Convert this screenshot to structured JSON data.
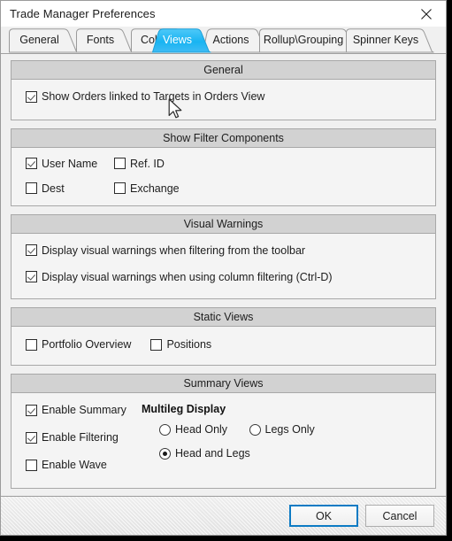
{
  "window": {
    "title": "Trade Manager Preferences",
    "close_icon": "close-icon"
  },
  "tabs": [
    {
      "label": "General",
      "active": false
    },
    {
      "label": "Fonts",
      "active": false
    },
    {
      "label": "Colors",
      "active": false
    },
    {
      "label": "Views",
      "active": true
    },
    {
      "label": "Actions",
      "active": false
    },
    {
      "label": "Rollup\\Grouping",
      "active": false
    },
    {
      "label": "Spinner Keys",
      "active": false
    }
  ],
  "groups": {
    "general": {
      "title": "General",
      "options": [
        {
          "label": "Show Orders linked to Targets in Orders View",
          "checked": true
        }
      ]
    },
    "filter_components": {
      "title": "Show Filter Components",
      "options": [
        {
          "label": "User Name",
          "checked": true
        },
        {
          "label": "Ref. ID",
          "checked": false
        },
        {
          "label": "Dest",
          "checked": false
        },
        {
          "label": "Exchange",
          "checked": false
        }
      ]
    },
    "visual_warnings": {
      "title": "Visual Warnings",
      "options": [
        {
          "label": "Display visual warnings when filtering from the toolbar",
          "checked": true
        },
        {
          "label": "Display visual warnings when using column filtering (Ctrl-D)",
          "checked": true
        }
      ]
    },
    "static_views": {
      "title": "Static Views",
      "options": [
        {
          "label": "Portfolio Overview",
          "checked": false
        },
        {
          "label": "Positions",
          "checked": false
        }
      ]
    },
    "summary_views": {
      "title": "Summary Views",
      "options": [
        {
          "label": "Enable Summary",
          "checked": true
        },
        {
          "label": "Enable Filtering",
          "checked": true
        },
        {
          "label": "Enable Wave",
          "checked": false
        }
      ],
      "multileg": {
        "title": "Multileg Display",
        "selected": "Head and Legs",
        "options": [
          {
            "label": "Head Only",
            "selected": false
          },
          {
            "label": "Legs Only",
            "selected": false
          },
          {
            "label": "Head and Legs",
            "selected": true
          }
        ]
      }
    }
  },
  "footer": {
    "ok_label": "OK",
    "cancel_label": "Cancel"
  },
  "colors": {
    "active_tab": "#29b6f6",
    "accent_focus": "#0d7bc4",
    "group_header": "#d2d2d2",
    "dialog_bg": "#f0f0f0"
  }
}
